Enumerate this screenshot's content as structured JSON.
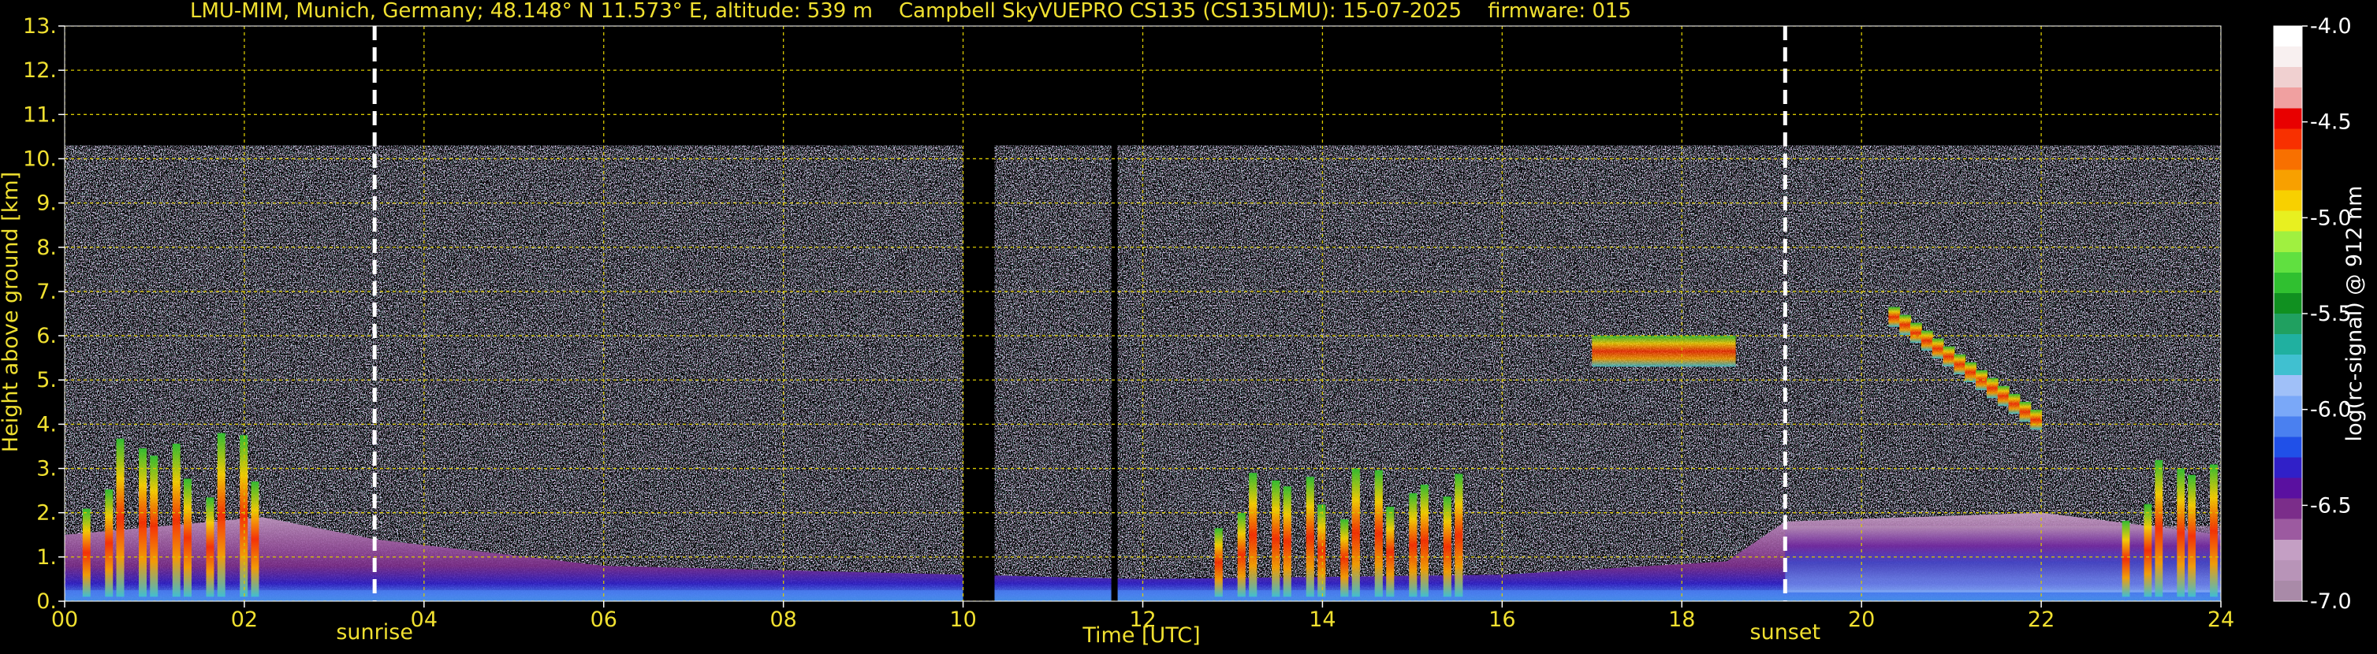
{
  "chart_data": {
    "type": "heatmap",
    "title": "LMU-MIM, Munich, Germany; 48.148° N 11.573° E, altitude: 539 m    Campbell SkyVUEPRO CS135 (CS135LMU): 15-07-2025    firmware: 015",
    "xlabel": "Time [UTC]",
    "ylabel": "Height above ground [km]",
    "colorbar_label": "log(rc-signal) @ 912 nm",
    "xlim": [
      0,
      24
    ],
    "ylim": [
      0,
      13
    ],
    "x_ticks": [
      0,
      2,
      4,
      6,
      8,
      10,
      12,
      14,
      16,
      18,
      20,
      22,
      24
    ],
    "x_tick_labels": [
      "00",
      "02",
      "04",
      "06",
      "08",
      "10",
      "12",
      "14",
      "16",
      "18",
      "20",
      "22",
      "24"
    ],
    "y_ticks": [
      0,
      1,
      2,
      3,
      4,
      5,
      6,
      7,
      8,
      9,
      10,
      11,
      12,
      13
    ],
    "y_tick_labels": [
      "0.",
      "1.",
      "2.",
      "3.",
      "4.",
      "5.",
      "6.",
      "7.",
      "8.",
      "9.",
      "10.",
      "11.",
      "12.",
      "13."
    ],
    "grid": true,
    "colorbar": {
      "range": [
        -7.0,
        -4.0
      ],
      "ticks": [
        -7.0,
        -6.5,
        -6.0,
        -5.5,
        -5.0,
        -4.5,
        -4.0
      ],
      "tick_labels": [
        "-7.0",
        "-6.5",
        "-6.0",
        "-5.5",
        "-5.0",
        "-4.5",
        "-4.0"
      ],
      "colors": [
        "#a98aa8",
        "#b894b8",
        "#c49fc4",
        "#9c5aa0",
        "#7b2d8a",
        "#5a10a0",
        "#3020c8",
        "#2050e8",
        "#4a80f0",
        "#7aa8f8",
        "#a0c0f8",
        "#40c0d0",
        "#20b0a0",
        "#20a060",
        "#109020",
        "#30c030",
        "#60e040",
        "#a0f040",
        "#e8f020",
        "#f8d000",
        "#f8a000",
        "#f87000",
        "#f83000",
        "#e80000",
        "#f0a0a0",
        "#f0d0d0",
        "#f8f0f0",
        "#ffffff"
      ]
    },
    "data_top_km": 10.3,
    "data_gaps_utc": [
      [
        10.0,
        10.35
      ],
      [
        11.65,
        11.72
      ]
    ],
    "events": [
      {
        "label": "sunrise",
        "time_utc": 3.45
      },
      {
        "label": "sunset",
        "time_utc": 19.15
      }
    ],
    "features": [
      {
        "name": "boundary layer aerosol",
        "t_start": 0.0,
        "t_end": 24.0,
        "base_km": 0.0,
        "top_km_profile": [
          [
            0,
            1.5
          ],
          [
            2.2,
            1.9
          ],
          [
            3.45,
            1.4
          ],
          [
            6,
            0.8
          ],
          [
            10,
            0.6
          ],
          [
            12,
            0.5
          ],
          [
            16,
            0.6
          ],
          [
            18.5,
            0.9
          ],
          [
            19.15,
            1.8
          ],
          [
            22,
            2.0
          ],
          [
            24,
            1.5
          ]
        ]
      },
      {
        "name": "mid-level cloud",
        "t_start": 17.0,
        "t_end": 18.6,
        "base_km": 5.3,
        "top_km": 6.0
      },
      {
        "name": "descending cloud layer",
        "t_start": 20.3,
        "t_end": 22.0,
        "base_km_start": 6.2,
        "base_km_end": 3.7
      },
      {
        "name": "low cumulus",
        "t_start": 0.2,
        "t_end": 2.2,
        "base_km": 0.1,
        "top_km": 3.8
      },
      {
        "name": "low cumulus",
        "t_start": 12.8,
        "t_end": 15.6,
        "base_km": 0.1,
        "top_km": 3.0
      },
      {
        "name": "low cumulus",
        "t_start": 22.9,
        "t_end": 24.0,
        "base_km": 0.1,
        "top_km": 3.3
      }
    ]
  }
}
